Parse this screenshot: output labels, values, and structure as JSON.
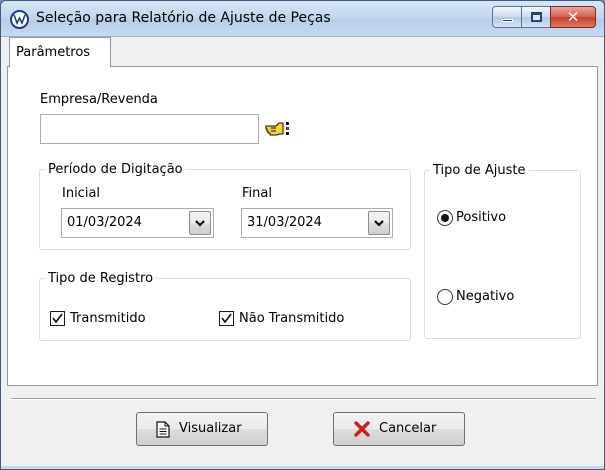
{
  "window": {
    "title": "Seleção para Relatório de Ajuste de Peças",
    "icon": "vw-logo-icon"
  },
  "tabs": [
    {
      "label": "Parâmetros",
      "active": true
    }
  ],
  "empresa": {
    "label": "Empresa/Revenda",
    "value": ""
  },
  "periodo": {
    "legend": "Período de Digitação",
    "inicial_label": "Inicial",
    "inicial_value": "01/03/2024",
    "final_label": "Final",
    "final_value": "31/03/2024"
  },
  "tipo_ajuste": {
    "legend": "Tipo de Ajuste",
    "options": [
      {
        "label": "Positivo",
        "selected": true
      },
      {
        "label": "Negativo",
        "selected": false
      }
    ]
  },
  "tipo_registro": {
    "legend": "Tipo de Registro",
    "options": [
      {
        "label": "Transmitido",
        "checked": true
      },
      {
        "label": "Não Transmitido",
        "checked": true
      }
    ]
  },
  "buttons": {
    "visualizar": "Visualizar",
    "cancelar": "Cancelar"
  },
  "colors": {
    "cancel_icon": "#cc1f1a",
    "accent_title": "#c3d7ef"
  }
}
